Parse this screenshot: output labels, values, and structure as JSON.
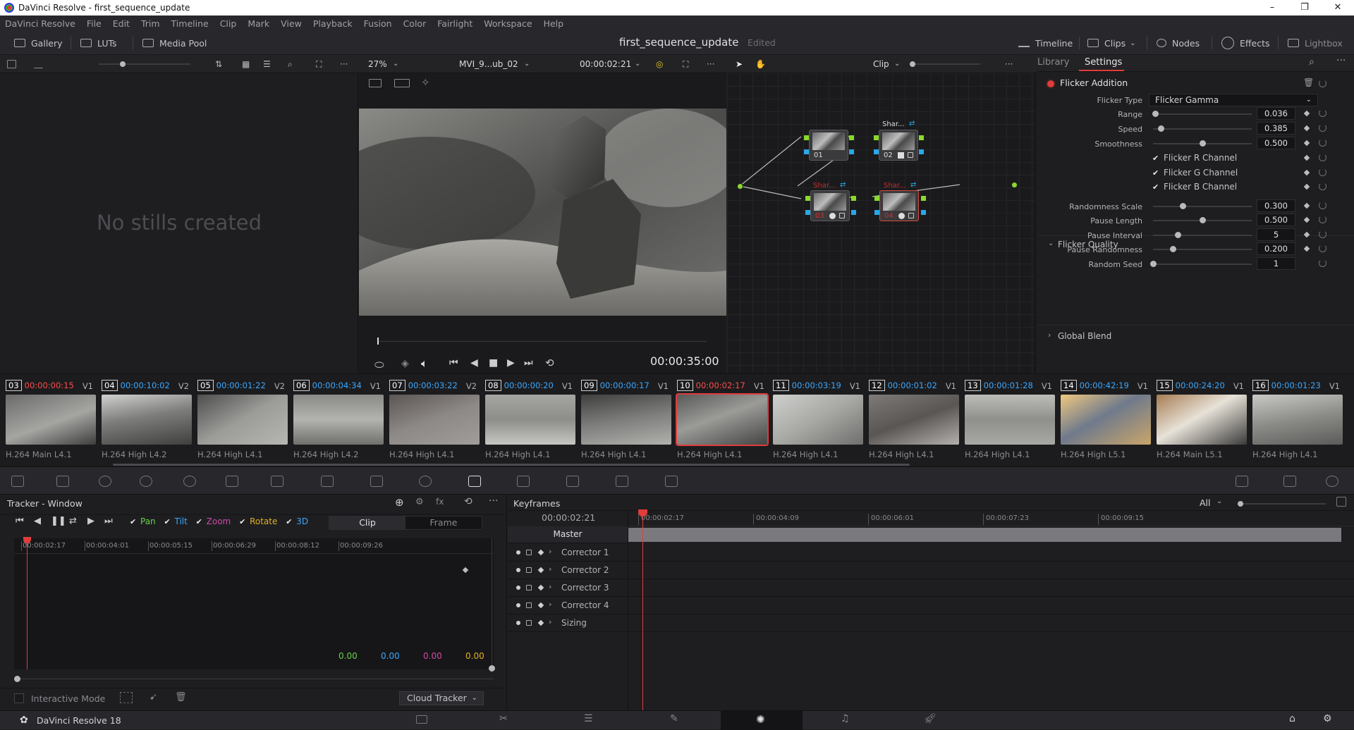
{
  "window": {
    "title": "DaVinci Resolve - first_sequence_update"
  },
  "menu": [
    "DaVinci Resolve",
    "File",
    "Edit",
    "Trim",
    "Timeline",
    "Clip",
    "Mark",
    "View",
    "Playback",
    "Fusion",
    "Color",
    "Fairlight",
    "Workspace",
    "Help"
  ],
  "pagebar": {
    "left": [
      "Gallery",
      "LUTs",
      "Media Pool"
    ],
    "project": "first_sequence_update",
    "status": "Edited",
    "right": [
      "Timeline",
      "Clips",
      "Nodes",
      "Effects",
      "Lightbox"
    ]
  },
  "viewer": {
    "zoom": "27%",
    "clip_name": "MVI_9...ub_02",
    "timecode": "00:00:02:21",
    "duration": "00:00:35:00"
  },
  "gallery": {
    "empty_text": "No stills created"
  },
  "nodes": {
    "mode": "Clip",
    "items": [
      {
        "id": "01",
        "label": ""
      },
      {
        "id": "02",
        "label": "Shar..."
      },
      {
        "id": "03",
        "label": "Shar..."
      },
      {
        "id": "04",
        "label": "Shar..."
      }
    ]
  },
  "inspector": {
    "tabs": [
      "Library",
      "Settings"
    ],
    "active_tab": "Settings",
    "effect": "Flicker Addition",
    "flicker_type_label": "Flicker Type",
    "flicker_type": "Flicker Gamma",
    "params": [
      {
        "label": "Range",
        "value": "0.036",
        "level": 0.02
      },
      {
        "label": "Speed",
        "value": "0.385",
        "level": 0.08
      },
      {
        "label": "Smoothness",
        "value": "0.500",
        "level": 0.5
      }
    ],
    "channels": [
      "Flicker R Channel",
      "Flicker G Channel",
      "Flicker B Channel"
    ],
    "quality_section": "Flicker Quality",
    "quality": [
      {
        "label": "Randomness Scale",
        "value": "0.300",
        "level": 0.3
      },
      {
        "label": "Pause Length",
        "value": "0.500",
        "level": 0.5
      },
      {
        "label": "Pause Interval",
        "value": "5",
        "level": 0.25
      },
      {
        "label": "Pause Randomness",
        "value": "0.200",
        "level": 0.2
      },
      {
        "label": "Random Seed",
        "value": "1",
        "level": 0.0
      }
    ],
    "global_blend": "Global Blend"
  },
  "clips": [
    {
      "num": "03",
      "tc": "00:00:00:15",
      "track": "V1",
      "codec": "H.264 Main L4.1",
      "red": true
    },
    {
      "num": "04",
      "tc": "00:00:10:02",
      "track": "V2",
      "codec": "H.264 High L4.2",
      "red": false
    },
    {
      "num": "05",
      "tc": "00:00:01:22",
      "track": "V2",
      "codec": "H.264 High L4.1",
      "red": false
    },
    {
      "num": "06",
      "tc": "00:00:04:34",
      "track": "V1",
      "codec": "H.264 High L4.2",
      "red": false
    },
    {
      "num": "07",
      "tc": "00:00:03:22",
      "track": "V2",
      "codec": "H.264 High L4.1",
      "red": false
    },
    {
      "num": "08",
      "tc": "00:00:00:20",
      "track": "V1",
      "codec": "H.264 High L4.1",
      "red": false
    },
    {
      "num": "09",
      "tc": "00:00:00:17",
      "track": "V1",
      "codec": "H.264 High L4.1",
      "red": false
    },
    {
      "num": "10",
      "tc": "00:00:02:17",
      "track": "V1",
      "codec": "H.264 High L4.1",
      "red": true
    },
    {
      "num": "11",
      "tc": "00:00:03:19",
      "track": "V1",
      "codec": "H.264 High L4.1",
      "red": false
    },
    {
      "num": "12",
      "tc": "00:00:01:02",
      "track": "V1",
      "codec": "H.264 High L4.1",
      "red": false
    },
    {
      "num": "13",
      "tc": "00:00:01:28",
      "track": "V1",
      "codec": "H.264 High L4.1",
      "red": false
    },
    {
      "num": "14",
      "tc": "00:00:42:19",
      "track": "V1",
      "codec": "H.264 High L5.1",
      "red": false
    },
    {
      "num": "15",
      "tc": "00:00:24:20",
      "track": "V1",
      "codec": "H.264 Main L5.1",
      "red": false
    },
    {
      "num": "16",
      "tc": "00:00:01:23",
      "track": "V1",
      "codec": "H.264 High L4.1",
      "red": false
    }
  ],
  "tracker": {
    "title": "Tracker - Window",
    "checks": [
      "Pan",
      "Tilt",
      "Zoom",
      "Rotate",
      "3D"
    ],
    "modes": [
      "Clip",
      "Frame"
    ],
    "ruler": [
      "00:00:02:17",
      "00:00:04:01",
      "00:00:05:15",
      "00:00:06:29",
      "00:00:08:12",
      "00:00:09:26"
    ],
    "values": [
      "0.00",
      "0.00",
      "0.00",
      "0.00"
    ],
    "interactive_mode": "Interactive Mode",
    "cloud_tracker": "Cloud Tracker"
  },
  "keyframes": {
    "title": "Keyframes",
    "filter": "All",
    "timecode": "00:00:02:21",
    "ruler": [
      "00:00:02:17",
      "00:00:04:09",
      "00:00:06:01",
      "00:00:07:23",
      "00:00:09:15"
    ],
    "master": "Master",
    "rows": [
      "Corrector 1",
      "Corrector 2",
      "Corrector 3",
      "Corrector 4",
      "Sizing"
    ]
  },
  "footer": {
    "app": "DaVinci Resolve 18"
  },
  "colors": {
    "accent_red": "#e03c3c",
    "timecode_blue": "#3aa8ff",
    "panel": "#1e1e21"
  }
}
